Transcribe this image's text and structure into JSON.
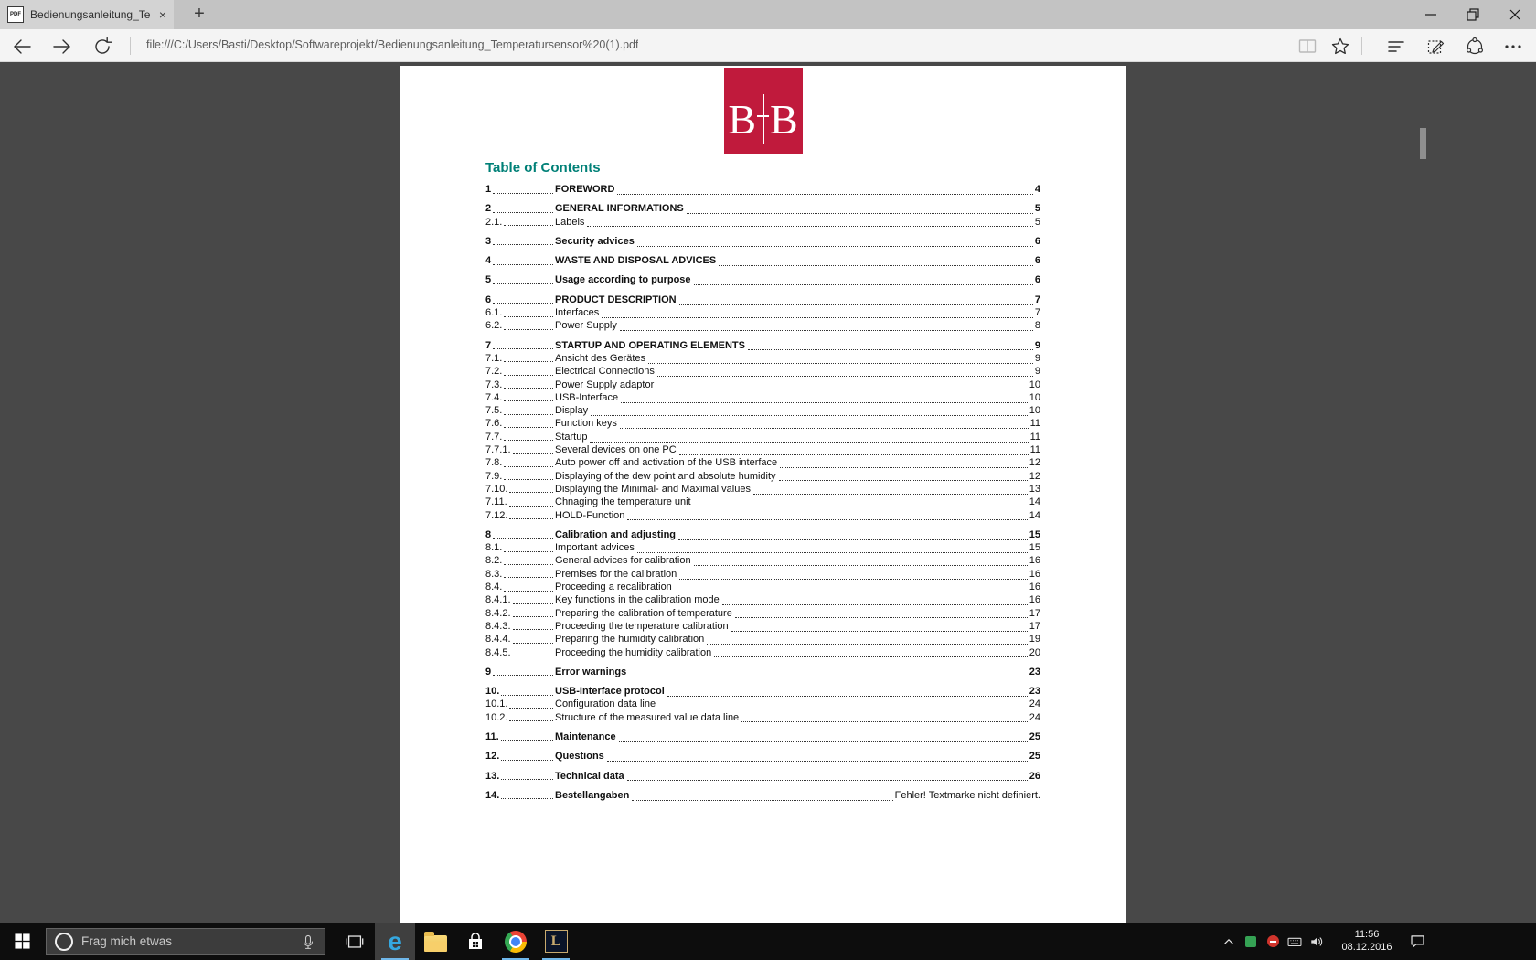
{
  "browser": {
    "tab_title": "Bedienungsanleitung_Te",
    "pdf_badge": "PDF",
    "tab_close_glyph": "×",
    "new_tab_glyph": "+",
    "url": "file:///C:/Users/Basti/Desktop/Softwareprojekt/Bedienungsanleitung_Temperatursensor%20(1).pdf"
  },
  "pdf": {
    "logo": {
      "left": "B",
      "right": "B"
    },
    "heading": "Table of Contents",
    "toc_groups": [
      {
        "entries": [
          {
            "num": "1",
            "title": "FOREWORD",
            "page": "4",
            "bold": true
          }
        ]
      },
      {
        "entries": [
          {
            "num": "2",
            "title": "GENERAL INFORMATIONS",
            "page": "5",
            "bold": true
          },
          {
            "num": "2.1.",
            "title": "Labels",
            "page": "5",
            "bold": false
          }
        ]
      },
      {
        "entries": [
          {
            "num": "3",
            "title": "Security advices",
            "page": "6",
            "bold": true
          }
        ]
      },
      {
        "entries": [
          {
            "num": "4",
            "title": "WASTE AND DISPOSAL ADVICES",
            "page": "6",
            "bold": true
          }
        ]
      },
      {
        "entries": [
          {
            "num": "5",
            "title": "Usage according to purpose",
            "page": "6",
            "bold": true
          }
        ]
      },
      {
        "entries": [
          {
            "num": "6",
            "title": "PRODUCT DESCRIPTION",
            "page": "7",
            "bold": true
          },
          {
            "num": "6.1.",
            "title": "Interfaces",
            "page": "7",
            "bold": false
          },
          {
            "num": "6.2.",
            "title": "Power Supply",
            "page": "8",
            "bold": false
          }
        ]
      },
      {
        "entries": [
          {
            "num": "7",
            "title": "STARTUP AND OPERATING ELEMENTS",
            "page": "9",
            "bold": true
          },
          {
            "num": "7.1.",
            "title": "Ansicht des Gerätes",
            "page": "9",
            "bold": false
          },
          {
            "num": "7.2.",
            "title": "Electrical Connections",
            "page": "9",
            "bold": false
          },
          {
            "num": "7.3.",
            "title": "Power Supply adaptor",
            "page": "10",
            "bold": false
          },
          {
            "num": "7.4.",
            "title": "USB-Interface",
            "page": "10",
            "bold": false
          },
          {
            "num": "7.5.",
            "title": "Display",
            "page": "10",
            "bold": false
          },
          {
            "num": "7.6.",
            "title": "Function keys",
            "page": "11",
            "bold": false
          },
          {
            "num": "7.7.",
            "title": "Startup",
            "page": "11",
            "bold": false
          },
          {
            "num": "7.7.1.",
            "title": "Several devices on one PC",
            "page": "11",
            "bold": false
          },
          {
            "num": "7.8.",
            "title": "Auto power off and activation of the USB interface",
            "page": "12",
            "bold": false
          },
          {
            "num": "7.9.",
            "title": "Displaying of the dew point and absolute humidity",
            "page": "12",
            "bold": false
          },
          {
            "num": "7.10.",
            "title": "Displaying the Minimal- and Maximal values",
            "page": "13",
            "bold": false
          },
          {
            "num": "7.11.",
            "title": "Chnaging the temperature unit",
            "page": "14",
            "bold": false
          },
          {
            "num": "7.12.",
            "title": "HOLD-Function",
            "page": "14",
            "bold": false
          }
        ]
      },
      {
        "entries": [
          {
            "num": "8",
            "title": "Calibration and adjusting",
            "page": "15",
            "bold": true
          },
          {
            "num": "8.1.",
            "title": "Important advices",
            "page": "15",
            "bold": false
          },
          {
            "num": "8.2.",
            "title": "General advices for calibration",
            "page": "16",
            "bold": false
          },
          {
            "num": "8.3.",
            "title": "Premises for the calibration",
            "page": "16",
            "bold": false
          },
          {
            "num": "8.4.",
            "title": "Proceeding a recalibration",
            "page": "16",
            "bold": false
          },
          {
            "num": "8.4.1.",
            "title": "Key functions in the calibration mode",
            "page": "16",
            "bold": false
          },
          {
            "num": "8.4.2.",
            "title": "Preparing the calibration of temperature",
            "page": "17",
            "bold": false
          },
          {
            "num": "8.4.3.",
            "title": "Proceeding the temperature calibration",
            "page": "17",
            "bold": false
          },
          {
            "num": "8.4.4.",
            "title": "Preparing the humidity calibration",
            "page": "19",
            "bold": false
          },
          {
            "num": "8.4.5.",
            "title": "Proceeding the humidity calibration",
            "page": "20",
            "bold": false
          }
        ]
      },
      {
        "entries": [
          {
            "num": "9",
            "title": "Error warnings",
            "page": "23",
            "bold": true
          }
        ]
      },
      {
        "entries": [
          {
            "num": "10.",
            "title": "USB-Interface protocol",
            "page": "23",
            "bold": true
          },
          {
            "num": "10.1.",
            "title": "Configuration data line",
            "page": "24",
            "bold": false
          },
          {
            "num": "10.2.",
            "title": "Structure of the measured value data line",
            "page": "24",
            "bold": false
          }
        ]
      },
      {
        "entries": [
          {
            "num": "11.",
            "title": "Maintenance",
            "page": "25",
            "bold": true
          }
        ]
      },
      {
        "entries": [
          {
            "num": "12.",
            "title": "Questions",
            "page": "25",
            "bold": true
          }
        ]
      },
      {
        "entries": [
          {
            "num": "13.",
            "title": "Technical data",
            "page": "26",
            "bold": true
          }
        ]
      },
      {
        "entries": [
          {
            "num": "14.",
            "title": "Bestellangaben",
            "page": "Fehler! Textmarke nicht definiert.",
            "bold": true,
            "plain_page": true
          }
        ]
      }
    ]
  },
  "taskbar": {
    "search_placeholder": "Frag mich etwas",
    "time": "11:56",
    "date": "08.12.2016"
  },
  "colors": {
    "logo_red": "#c01a3c",
    "heading_teal": "#008077",
    "content_bg": "#484848",
    "taskbar_bg": "#0d0d0d",
    "accent_underline": "#6fb7ea"
  }
}
